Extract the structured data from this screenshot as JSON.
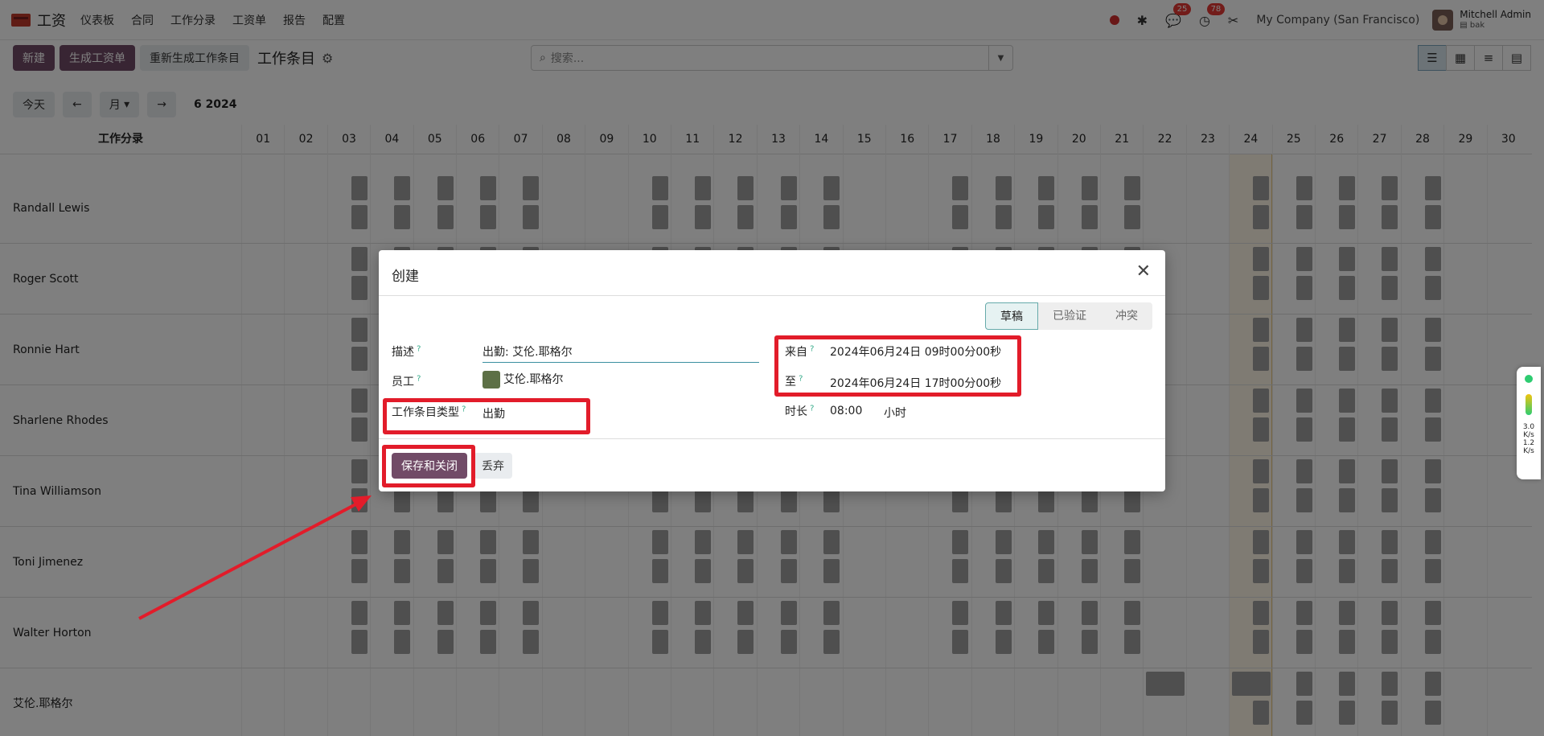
{
  "app": {
    "brand": "工资",
    "menu": [
      "仪表板",
      "合同",
      "工作分录",
      "工资单",
      "报告",
      "配置"
    ]
  },
  "nav_right": {
    "messages_count": "25",
    "activities_count": "78",
    "company": "My Company (San Francisco)",
    "user_name": "Mitchell Admin",
    "user_db": "bak"
  },
  "control": {
    "new_label": "新建",
    "generate_payslip_label": "生成工资单",
    "regenerate_label": "重新生成工作条目",
    "title": "工作条目",
    "search_placeholder": "搜索..."
  },
  "nav2": {
    "today_label": "今天",
    "prev_label": "←",
    "month_label": "月",
    "next_label": "→",
    "period": "6 2024"
  },
  "gantt": {
    "header_label": "工作分录",
    "days": [
      "01",
      "02",
      "03",
      "04",
      "05",
      "06",
      "07",
      "08",
      "09",
      "10",
      "11",
      "12",
      "13",
      "14",
      "15",
      "16",
      "17",
      "18",
      "19",
      "20",
      "21",
      "22",
      "23",
      "24",
      "25",
      "26",
      "27",
      "28",
      "29",
      "30"
    ],
    "employees": [
      "Randall Lewis",
      "Roger Scott",
      "Ronnie Hart",
      "Sharlene Rhodes",
      "Tina Williamson",
      "Toni Jimenez",
      "Walter Horton",
      "艾伦.耶格尔"
    ]
  },
  "dialog": {
    "title": "创建",
    "stages": [
      "草稿",
      "已验证",
      "冲突"
    ],
    "desc_label": "描述",
    "desc_value": "出勤: 艾伦.耶格尔",
    "employee_label": "员工",
    "employee_value": "艾伦.耶格尔",
    "type_label": "工作条目类型",
    "type_value": "出勤",
    "from_label": "来自",
    "from_value": "2024年06月24日 09时00分00秒",
    "to_label": "至",
    "to_value": "2024年06月24日 17时00分00秒",
    "duration_label": "时长",
    "duration_value": "08:00",
    "duration_unit": "小时",
    "save_label": "保存和关闭",
    "discard_label": "丢弃"
  },
  "side_widget": {
    "up_speed": "3.0",
    "down_speed": "1.2",
    "unit": "K/s"
  }
}
